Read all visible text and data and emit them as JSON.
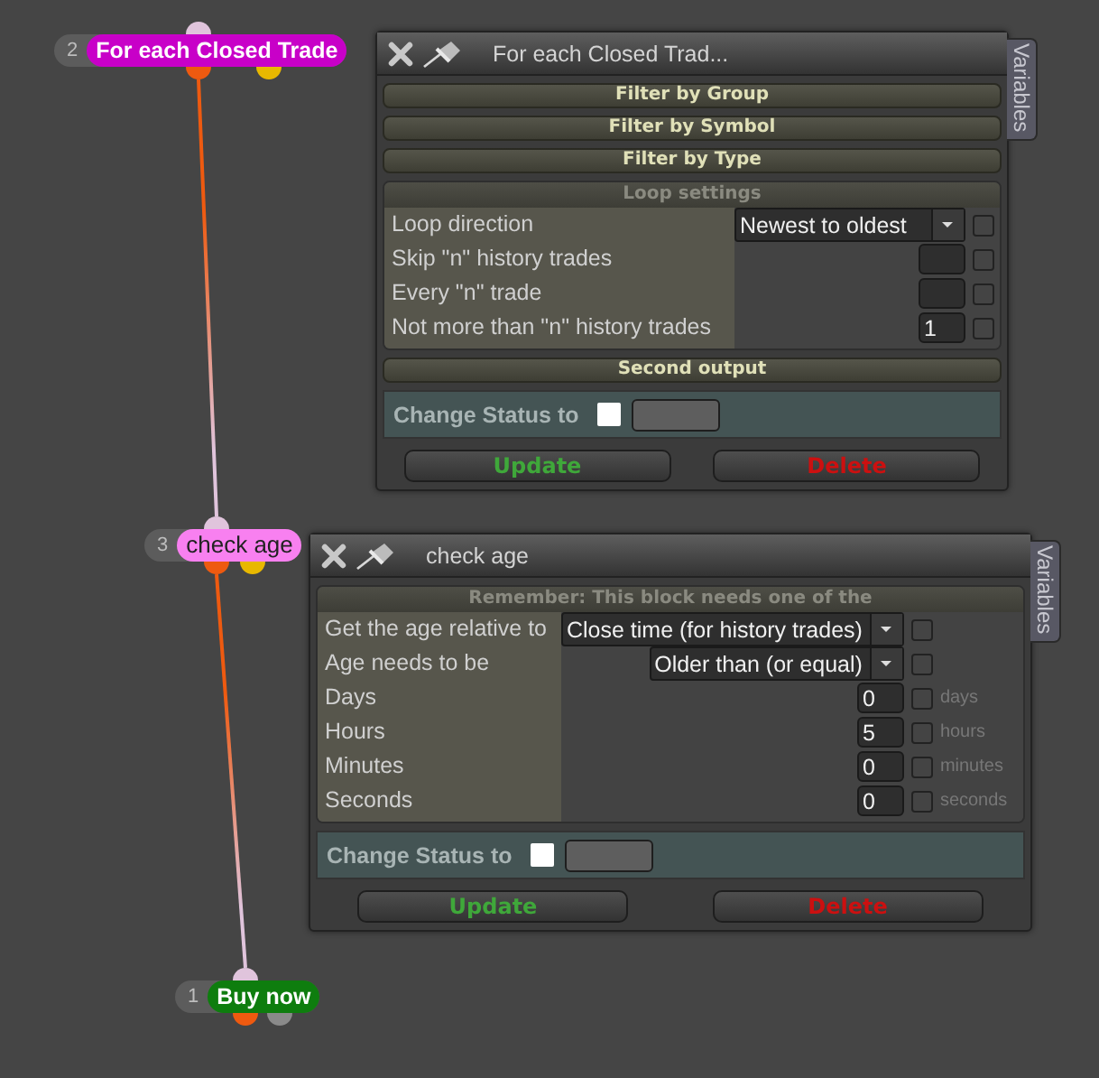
{
  "nodes": [
    {
      "number": "2",
      "label": "For each Closed Trade",
      "color": "#c800c8",
      "outputs": [
        {
          "color": "#ee5a10"
        },
        {
          "color": "#e8b800"
        }
      ]
    },
    {
      "number": "3",
      "label": "check age",
      "color": "#f880f0",
      "outputs": [
        {
          "color": "#ee5a10"
        },
        {
          "color": "#e8b800"
        }
      ]
    },
    {
      "number": "1",
      "label": "Buy now",
      "color": "#0e7d0e",
      "outputs": [
        {
          "color": "#ee5a10"
        },
        {
          "color": "#8a8a8a"
        }
      ]
    }
  ],
  "panels": [
    {
      "title": "For each Closed Trad...",
      "side_tab": "Variables",
      "sections": [
        {
          "kind": "bar",
          "label": "Filter by Group"
        },
        {
          "kind": "bar",
          "label": "Filter by Symbol"
        },
        {
          "kind": "bar",
          "label": "Filter by Type"
        },
        {
          "kind": "group",
          "label": "Loop settings",
          "rows": [
            {
              "kind": "select",
              "label": "Loop direction",
              "value": "Newest to oldest",
              "checked": false
            },
            {
              "kind": "number",
              "label": "Skip \"n\" history trades",
              "value": "",
              "checked": false
            },
            {
              "kind": "number",
              "label": "Every \"n\" trade",
              "value": "",
              "checked": false
            },
            {
              "kind": "number",
              "label": "Not more than \"n\" history trades",
              "value": "1",
              "checked": false
            }
          ]
        },
        {
          "kind": "bar",
          "label": "Second output"
        }
      ],
      "status": {
        "label": "Change Status to",
        "checked": false
      },
      "buttons": [
        {
          "kind": "update",
          "label": "Update"
        },
        {
          "kind": "delete",
          "label": "Delete"
        }
      ]
    },
    {
      "title": "check age",
      "side_tab": "Variables",
      "sections": [
        {
          "kind": "group",
          "label": "Remember: This block needs one of the",
          "rows": [
            {
              "kind": "select",
              "label": "Get the age relative to",
              "value": "Close time (for history trades)",
              "checked": false
            },
            {
              "kind": "select",
              "label": "Age needs to be",
              "value": "Older than (or equal)",
              "checked": false
            },
            {
              "kind": "number",
              "label": "Days",
              "value": "0",
              "checked": false,
              "unit": "days"
            },
            {
              "kind": "number",
              "label": "Hours",
              "value": "5",
              "checked": false,
              "unit": "hours"
            },
            {
              "kind": "number",
              "label": "Minutes",
              "value": "0",
              "checked": false,
              "unit": "minutes"
            },
            {
              "kind": "number",
              "label": "Seconds",
              "value": "0",
              "checked": false,
              "unit": "seconds"
            }
          ]
        }
      ],
      "status": {
        "label": "Change Status to",
        "checked": false
      },
      "buttons": [
        {
          "kind": "update",
          "label": "Update"
        },
        {
          "kind": "delete",
          "label": "Delete"
        }
      ]
    }
  ]
}
